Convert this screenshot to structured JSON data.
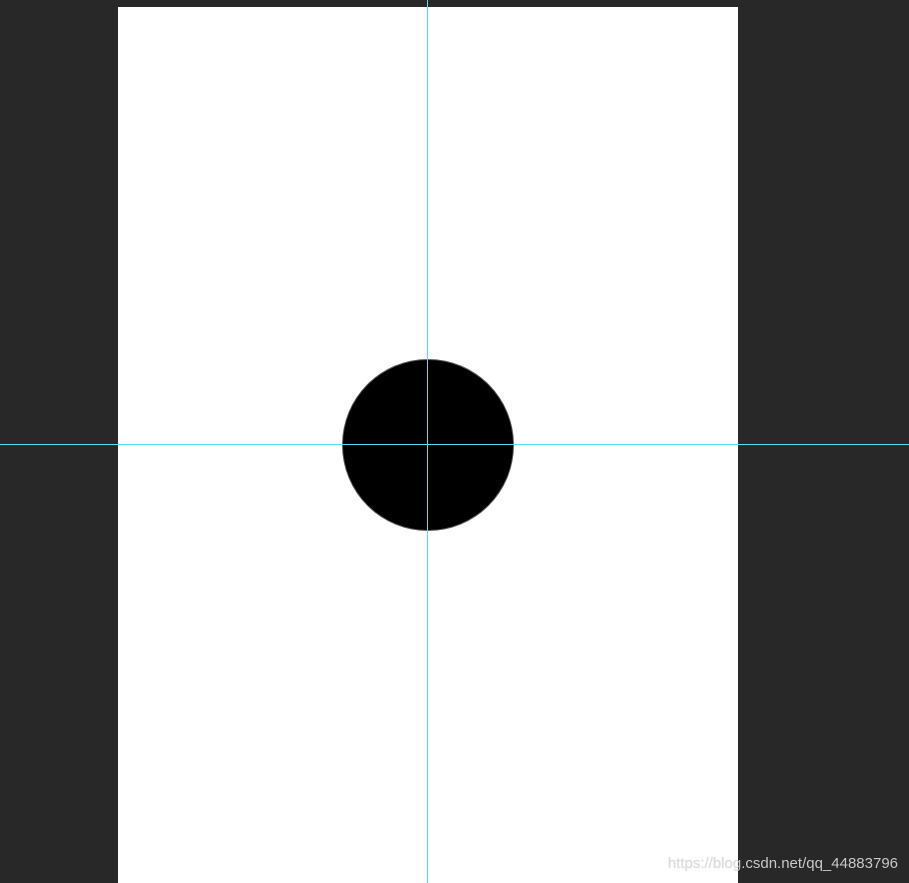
{
  "colors": {
    "workspace_background": "#282828",
    "document_background": "#ffffff",
    "shape_fill": "#000000",
    "guide_color": "#4fe3ee",
    "watermark_color": "#dcdcdc"
  },
  "canvas": {
    "shape": {
      "type": "ellipse",
      "icon": "black-circle-shape"
    },
    "guides": [
      "vertical",
      "horizontal"
    ]
  },
  "watermark": {
    "text": "https://blog.csdn.net/qq_44883796"
  }
}
